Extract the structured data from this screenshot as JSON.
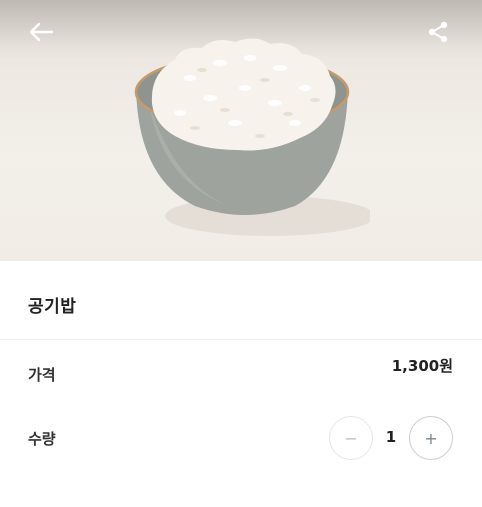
{
  "header": {
    "back_icon": "arrow-left-icon",
    "share_icon": "share-icon"
  },
  "product": {
    "image_subject": "bowl-of-rice",
    "name": "공기밥"
  },
  "price": {
    "label": "가격",
    "value": "1,300원"
  },
  "quantity": {
    "label": "수량",
    "value": "1",
    "decrement_symbol": "−",
    "increment_symbol": "+"
  },
  "colors": {
    "stepper_minus_border": "#e4e7ec",
    "stepper_plus_border": "#c9ced6",
    "text_primary": "#222222"
  }
}
